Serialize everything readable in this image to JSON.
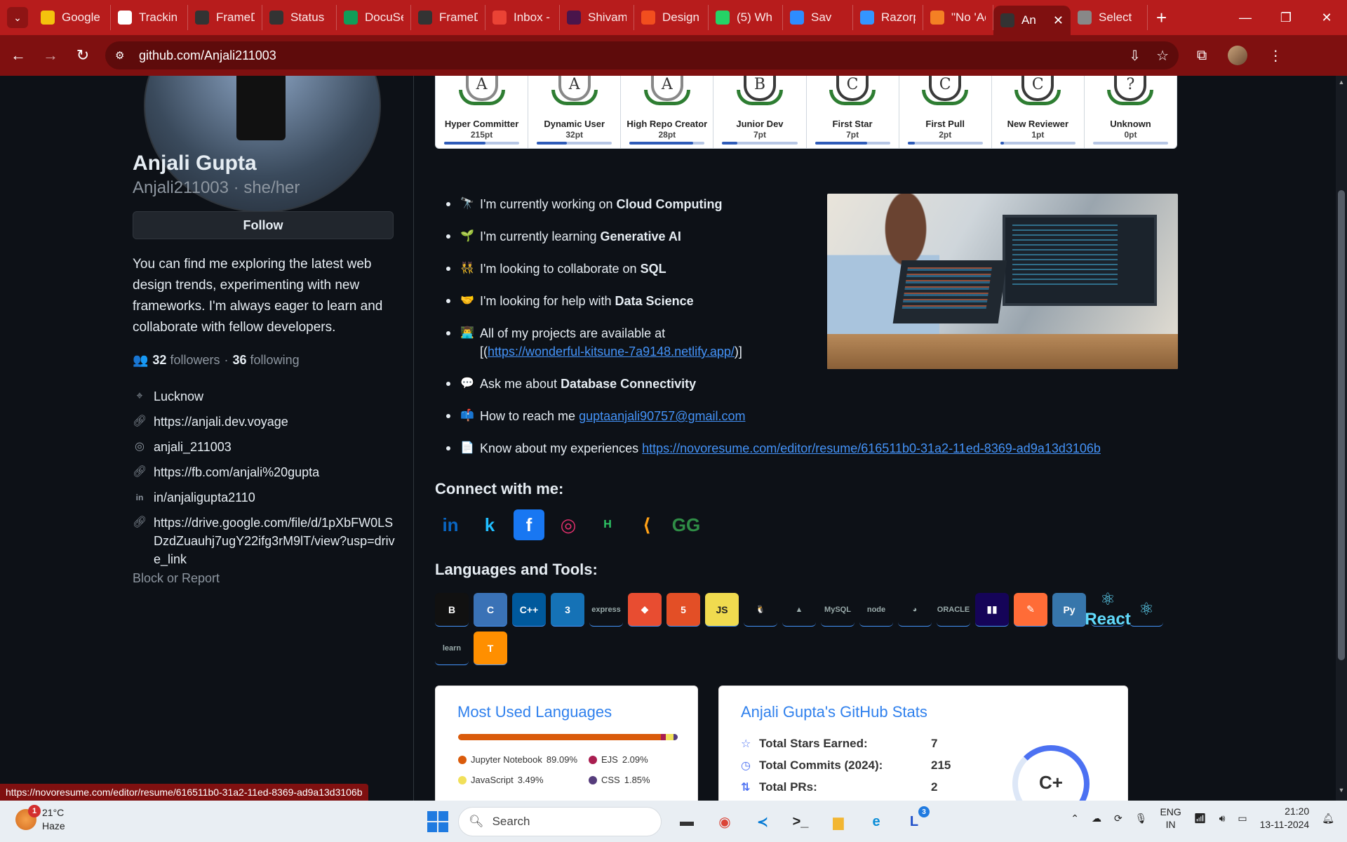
{
  "browser": {
    "tabs": [
      {
        "title": "Google",
        "icon": "sticky-note-icon",
        "color": "#f4c20d"
      },
      {
        "title": "Trackin",
        "icon": "openai-icon",
        "color": "#ffffff"
      },
      {
        "title": "FrameD",
        "icon": "github-icon",
        "color": "#333333"
      },
      {
        "title": "Status",
        "icon": "github-icon",
        "color": "#333333"
      },
      {
        "title": "DocuSe",
        "icon": "sheets-icon",
        "color": "#0f9d58"
      },
      {
        "title": "FrameD",
        "icon": "github-icon",
        "color": "#333333"
      },
      {
        "title": "Inbox -",
        "icon": "gmail-icon",
        "color": "#ea4335"
      },
      {
        "title": "Shivam",
        "icon": "slack-icon",
        "color": "#4a154b"
      },
      {
        "title": "Design",
        "icon": "figma-icon",
        "color": "#f24e1e"
      },
      {
        "title": "(5) Wh",
        "icon": "whatsapp-icon",
        "color": "#25d366"
      },
      {
        "title": "Sav",
        "icon": "zoom-icon",
        "color": "#2d8cff"
      },
      {
        "title": "Razorp",
        "icon": "razorpay-icon",
        "color": "#3395ff"
      },
      {
        "title": "\"No 'Ac",
        "icon": "stackoverflow-icon",
        "color": "#f48024"
      },
      {
        "title": "An",
        "icon": "github-icon",
        "color": "#333333",
        "active": true
      },
      {
        "title": "Select",
        "icon": "globe-icon",
        "color": "#888888"
      }
    ],
    "url": "github.com/Anjali211003"
  },
  "profile": {
    "name": "Anjali Gupta",
    "handle": "Anjali211003 · she/her",
    "follow_label": "Follow",
    "bio": "You can find me exploring the latest web design trends, experimenting with new frameworks. I'm always eager to learn and collaborate with fellow developers.",
    "followers_count": "32",
    "followers_label": "followers",
    "separator": "·",
    "following_count": "36",
    "following_label": "following",
    "details": [
      {
        "icon": "location-icon",
        "text": "Lucknow"
      },
      {
        "icon": "link-icon",
        "text": "https://anjali.dev.voyage"
      },
      {
        "icon": "instagram-icon",
        "text": "anjali_211003"
      },
      {
        "icon": "link-icon",
        "text": "https://fb.com/anjali%20gupta"
      },
      {
        "icon": "linkedin-icon",
        "text": "in/anjaligupta2110"
      },
      {
        "icon": "link-icon",
        "text": "https://drive.google.com/file/d/1pXbFW0LSDzdZuauhj7ugY22ifg3rM9lT/view?usp=drive_link"
      }
    ],
    "block_report": "Block or Report"
  },
  "trophies": [
    {
      "rank": "A",
      "name": "Hyper Committer",
      "points": "215pt",
      "progress": 0.55
    },
    {
      "rank": "A",
      "name": "Dynamic User",
      "points": "32pt",
      "progress": 0.4
    },
    {
      "rank": "A",
      "name": "High Repo Creator",
      "points": "28pt",
      "progress": 0.85
    },
    {
      "rank": "B",
      "name": "Junior Dev",
      "points": "7pt",
      "progress": 0.2
    },
    {
      "rank": "C",
      "name": "First Star",
      "points": "7pt",
      "progress": 0.7
    },
    {
      "rank": "C",
      "name": "First Pull",
      "points": "2pt",
      "progress": 0.1
    },
    {
      "rank": "C",
      "name": "New Reviewer",
      "points": "1pt",
      "progress": 0.05
    },
    {
      "rank": "?",
      "name": "Unknown",
      "points": "0pt",
      "progress": 0.0
    }
  ],
  "readme": {
    "bullets": [
      {
        "emoji": "🔭",
        "prefix": "I'm currently working on ",
        "bold": "Cloud Computing"
      },
      {
        "emoji": "🌱",
        "prefix": "I'm currently learning ",
        "bold": "Generative AI"
      },
      {
        "emoji": "👯",
        "prefix": "I'm looking to collaborate on ",
        "bold": "SQL"
      },
      {
        "emoji": "🤝",
        "prefix": "I'm looking for help with ",
        "bold": "Data Science"
      },
      {
        "emoji": "👨‍💻",
        "prefix": "All of my projects are available at [(",
        "link": "https://wonderful-kitsune-7a9148.netlify.app/",
        "suffix": ")]"
      },
      {
        "emoji": "💬",
        "prefix": "Ask me about ",
        "bold": "Database Connectivity"
      },
      {
        "emoji": "📫",
        "prefix": "How to reach me ",
        "link": "guptaanjali90757@gmail.com"
      },
      {
        "emoji": "📄",
        "prefix": "Know about my experiences ",
        "link": "https://novoresume.com/editor/resume/616511b0-31a2-11ed-8369-ad9a13d3106b"
      }
    ],
    "connect_heading": "Connect with me:",
    "socials": [
      {
        "icon": "linkedin-icon",
        "glyph": "in",
        "color": "#0a66c2"
      },
      {
        "icon": "kaggle-icon",
        "glyph": "k",
        "color": "#20beff"
      },
      {
        "icon": "facebook-icon",
        "glyph": "f",
        "color": "#1877f2"
      },
      {
        "icon": "instagram-icon",
        "glyph": "◎",
        "color": "#e1306c"
      },
      {
        "icon": "hackerrank-icon",
        "glyph": "H",
        "color": "#2ec866"
      },
      {
        "icon": "leetcode-icon",
        "glyph": "⟨",
        "color": "#ffa116"
      },
      {
        "icon": "geeksforgeeks-icon",
        "glyph": "GG",
        "color": "#2f8d46"
      }
    ],
    "tools_heading": "Languages and Tools:",
    "tools": [
      {
        "icon": "bootstrap-icon",
        "glyph": "B",
        "color": "#111111"
      },
      {
        "icon": "c-icon",
        "glyph": "C",
        "color": "#3a72b6"
      },
      {
        "icon": "cplusplus-icon",
        "glyph": "C++",
        "color": "#00599c"
      },
      {
        "icon": "css3-icon",
        "glyph": "3",
        "color": "#1572b6"
      },
      {
        "icon": "express-icon",
        "glyph": "express",
        "color": "transparent"
      },
      {
        "icon": "git-icon",
        "glyph": "◆",
        "color": "#e84d31"
      },
      {
        "icon": "html5-icon",
        "glyph": "5",
        "color": "#e34f26"
      },
      {
        "icon": "javascript-icon",
        "glyph": "JS",
        "color": "#f0db4f"
      },
      {
        "icon": "linux-icon",
        "glyph": "🐧",
        "color": "transparent"
      },
      {
        "icon": "mongodb-icon",
        "glyph": "▲",
        "color": "transparent"
      },
      {
        "icon": "mysql-icon",
        "glyph": "MySQL",
        "color": "transparent"
      },
      {
        "icon": "nodejs-icon",
        "glyph": "node",
        "color": "transparent"
      },
      {
        "icon": "opencv-icon",
        "glyph": "◕",
        "color": "transparent"
      },
      {
        "icon": "oracle-icon",
        "glyph": "ORACLE",
        "color": "transparent"
      },
      {
        "icon": "pandas-icon",
        "glyph": "▮▮",
        "color": "#150458"
      },
      {
        "icon": "postman-icon",
        "glyph": "✎",
        "color": "#ff6c37"
      },
      {
        "icon": "python-icon",
        "glyph": "Py",
        "color": "#3776ab"
      },
      {
        "icon": "react-icon",
        "glyph": "⚛",
        "color": "transparent",
        "label": "React"
      },
      {
        "icon": "react-native-icon",
        "glyph": "⚛",
        "color": "transparent"
      },
      {
        "icon": "scikit-learn-icon",
        "glyph": "learn",
        "color": "transparent"
      },
      {
        "icon": "tensorflow-icon",
        "glyph": "T",
        "color": "#ff8f00"
      }
    ]
  },
  "lang_card": {
    "title": "Most Used Languages",
    "languages": [
      {
        "name": "Jupyter Notebook",
        "percent": 89.09,
        "label": "89.09%",
        "color": "#da5b0b"
      },
      {
        "name": "EJS",
        "percent": 2.09,
        "label": "2.09%",
        "color": "#a91e50"
      },
      {
        "name": "JavaScript",
        "percent": 3.49,
        "label": "3.49%",
        "color": "#f1e05a"
      },
      {
        "name": "CSS",
        "percent": 1.85,
        "label": "1.85%",
        "color": "#563d7c"
      }
    ]
  },
  "stats_card": {
    "title": "Anjali Gupta's GitHub Stats",
    "rows": [
      {
        "icon": "star-icon",
        "label": "Total Stars Earned:",
        "value": "7"
      },
      {
        "icon": "clock-icon",
        "label": "Total Commits (2024):",
        "value": "215"
      },
      {
        "icon": "pull-request-icon",
        "label": "Total PRs:",
        "value": "2"
      }
    ],
    "rank": "C+"
  },
  "status_bar_url": "https://novoresume.com/editor/resume/616511b0-31a2-11ed-8369-ad9a13d3106b",
  "taskbar": {
    "weather_temp": "21°C",
    "weather_desc": "Haze",
    "weather_badge": "1",
    "search_placeholder": "Search",
    "apps": [
      {
        "icon": "file-explorer-dark-icon",
        "glyph": "▬"
      },
      {
        "icon": "chrome-icon",
        "glyph": "◉"
      },
      {
        "icon": "vscode-icon",
        "glyph": "≺"
      },
      {
        "icon": "terminal-icon",
        "glyph": ">_"
      },
      {
        "icon": "folder-icon",
        "glyph": "▆"
      },
      {
        "icon": "edge-icon",
        "glyph": "e"
      },
      {
        "icon": "lightshot-icon",
        "glyph": "L",
        "badge": "3"
      }
    ],
    "lang_primary": "ENG",
    "lang_secondary": "IN",
    "time": "21:20",
    "date": "13-11-2024"
  },
  "colors": {
    "chrome_red": "#b71c1c",
    "chrome_dark_red": "#7f1010",
    "github_bg": "#0d1117",
    "link_blue": "#4493f8"
  }
}
